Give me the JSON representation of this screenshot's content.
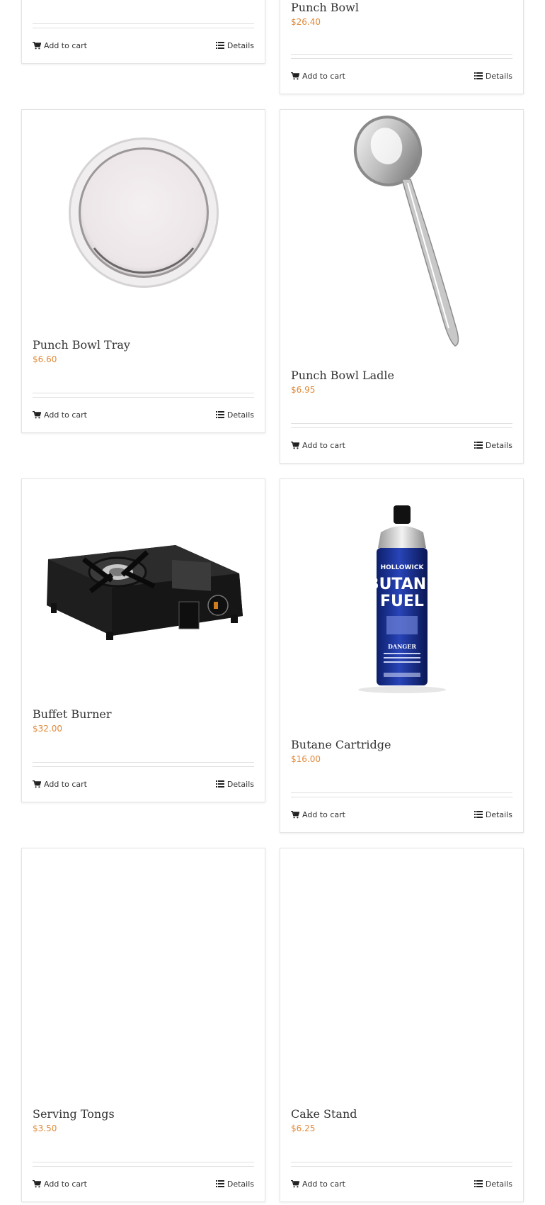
{
  "products": [
    {
      "title": "",
      "price": "",
      "add_label": "Add to cart",
      "details_label": "Details"
    },
    {
      "title": "Punch Bowl",
      "price": "$26.40",
      "add_label": "Add to cart",
      "details_label": "Details"
    },
    {
      "title": "Punch Bowl Tray",
      "price": "$6.60",
      "add_label": "Add to cart",
      "details_label": "Details"
    },
    {
      "title": "Punch Bowl Ladle",
      "price": "$6.95",
      "add_label": "Add to cart",
      "details_label": "Details"
    },
    {
      "title": "Buffet Burner",
      "price": "$32.00",
      "add_label": "Add to cart",
      "details_label": "Details"
    },
    {
      "title": "Butane Cartridge",
      "price": "$16.00",
      "add_label": "Add to cart",
      "details_label": "Details"
    },
    {
      "title": "Serving Tongs",
      "price": "$3.50",
      "add_label": "Add to cart",
      "details_label": "Details"
    },
    {
      "title": "Cake Stand",
      "price": "$6.25",
      "add_label": "Add to cart",
      "details_label": "Details"
    }
  ],
  "icons": {
    "cart": "cart-icon",
    "details": "list-icon"
  },
  "colors": {
    "price": "#e08a3a",
    "border": "#e4e4e4",
    "text": "#333333"
  },
  "butane_label": {
    "brand": "HOLLOWICK",
    "line1": "BUTANE",
    "line2": "FUEL",
    "warning": "DANGER"
  }
}
